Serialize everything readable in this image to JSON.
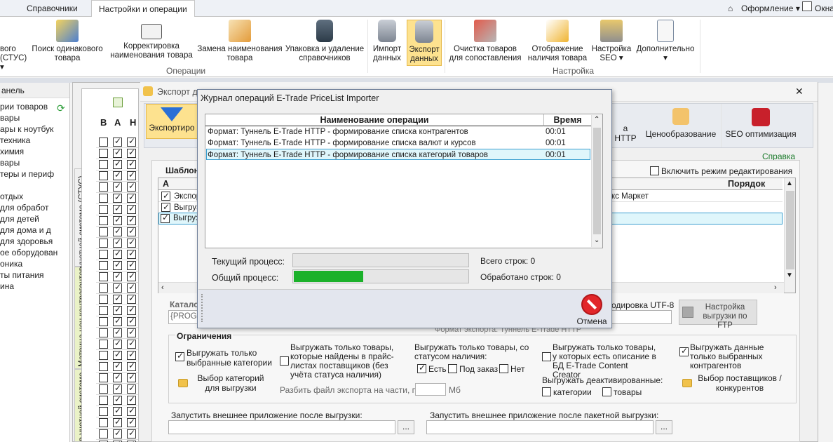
{
  "top_tabs": [
    "Справочники",
    "Настройки и операции"
  ],
  "top_right": {
    "appearance": "Оформление",
    "window": "Окна"
  },
  "ribbon": {
    "left_cut": [
      "вого",
      "(СТУС)"
    ],
    "operations": [
      {
        "label": "Поиск одинакового товара"
      },
      {
        "label": "Корректировка наименования товара"
      },
      {
        "label": "Замена наименования товара"
      },
      {
        "label": "Упаковка и удаление справочников"
      },
      {
        "label": "Импорт данных"
      },
      {
        "label": "Экспорт данных"
      }
    ],
    "settings": [
      {
        "label": "Очистка товаров для сопоставления"
      },
      {
        "label": "Отображение наличия товара"
      },
      {
        "label": "Настройка SEO"
      },
      {
        "label": "Дополнительно"
      }
    ],
    "group_operations": "Операции",
    "group_settings": "Настройка"
  },
  "left_panel": {
    "header": "анель",
    "items": [
      "рии товаров",
      "вары",
      "ары к ноутбук",
      "техника",
      "химия",
      "вары",
      "теры и периф",
      "",
      "отдых",
      "для обработ",
      "для детей",
      "для дома и д",
      "для здоровья",
      "ое оборудован",
      "оника",
      "ты питания",
      "ина"
    ]
  },
  "vertical_tabs": [
    "Товары в учетной системе (СТУС)",
    "Матрица цен контрагентов",
    "в учетной системе"
  ],
  "matrix_headers": [
    "В",
    "А",
    "Н"
  ],
  "export_window": {
    "title": "Экспорт д",
    "toolbar": [
      "Экспортиро",
      "а HTTP",
      "Ценообразование",
      "SEO оптимизация"
    ],
    "help": "Справка",
    "templates_label": "Шаблон",
    "edit_mode": "Включить режим редактирования",
    "grid_headers": [
      "А",
      "Порядок"
    ],
    "grid_rows": [
      {
        "checked": true,
        "name": "Экспор",
        "right": "кс Маркет"
      },
      {
        "checked": true,
        "name": "Выгрузк",
        "right": ""
      },
      {
        "checked": true,
        "name": "Выгрузк",
        "right": ""
      }
    ],
    "catalog_label": "Катало",
    "catalog_value": "{PROGR",
    "encoding": "одировка UTF-8",
    "ftp_button": "Настройка выгрузки по FTP",
    "format_caption": "Формат экспорта: Туннель E-Trade HTTP",
    "limits_title": "Ограничения",
    "limits": {
      "only_selected_categories": "Выгружать только выбранные категории",
      "only_found_in_pricelists": "Выгружать только товары, которые найдены в прайс-листах поставщиков (без учёта статуса наличия)",
      "only_with_status": "Выгружать только товары, со статусом наличия:",
      "status_yes": "Есть",
      "status_order": "Под заказ",
      "status_no": "Нет",
      "only_with_description": "Выгружать только товары, у которых есть описание в БД E-Trade Content Creator",
      "only_selected_contractors": "Выгружать данные только выбранных контрагентов",
      "select_categories": "Выбор категорий для выгрузки",
      "split_file": "Разбить файл экспорта на части, по:",
      "mb": "Мб",
      "deactivated": "Выгружать деактивированные:",
      "deact_categories": "категории",
      "deact_goods": "товары",
      "select_suppliers": "Выбор поставщиков / конкурентов"
    },
    "run_after": "Запустить внешнее приложение после выгрузки:",
    "run_after_batch": "Запустить внешнее приложение после пакетной выгрузки:",
    "dots": "..."
  },
  "journal": {
    "title": "Журнал операций E-Trade PriceList Importer",
    "col_name": "Наименование операции",
    "col_time": "Время",
    "rows": [
      {
        "name": "Формат: Туннель E-Trade HTTP - формирование списка контрагентов",
        "time": "00:01"
      },
      {
        "name": "Формат: Туннель E-Trade HTTP - формирование списка валют и курсов",
        "time": "00:01"
      },
      {
        "name": "Формат: Туннель E-Trade HTTP - формирование списка категорий товаров",
        "time": "00:01"
      }
    ],
    "current_process": "Текущий процесс:",
    "total_process": "Общий процесс:",
    "total_rows": "Всего строк: 0",
    "processed_rows": "Обработано строк: 0",
    "current_progress": 0,
    "total_progress": 0.4,
    "cancel": "Отмена"
  },
  "colors": {
    "accent_tab": "#fde28f",
    "progress": "#1bb12a",
    "selection": "#dff6fb"
  }
}
